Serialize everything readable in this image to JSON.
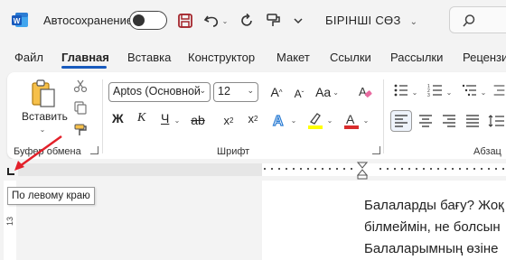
{
  "titlebar": {
    "app_icon": "word-logo-icon",
    "autosave_label": "Автосохранение",
    "autosave_on": false,
    "doc_title": "БІРІНШІ СӨЗ",
    "search_icon": "search-icon"
  },
  "tabs": [
    {
      "label": "Файл",
      "active": false
    },
    {
      "label": "Главная",
      "active": true
    },
    {
      "label": "Вставка",
      "active": false
    },
    {
      "label": "Конструктор",
      "active": false
    },
    {
      "label": "Макет",
      "active": false
    },
    {
      "label": "Ссылки",
      "active": false
    },
    {
      "label": "Рассылки",
      "active": false
    },
    {
      "label": "Рецензи",
      "active": false
    }
  ],
  "ribbon": {
    "clipboard": {
      "paste_label": "Вставить",
      "group_label": "Буфер обмена"
    },
    "font": {
      "font_name": "Aptos (Основной",
      "font_size": "12",
      "bold": "Ж",
      "italic": "К",
      "underline": "Ч",
      "group_label": "Шрифт"
    },
    "paragraph": {
      "group_label": "Абзац"
    }
  },
  "tooltip": "По левому краю",
  "vruler_number": "13",
  "document": {
    "lines": [
      "Балаларды бағу? Жоқ",
      "білмеймін, не болсын",
      "Балаларымның өзіне"
    ]
  },
  "colors": {
    "accent": "#185abd",
    "highlight": "#ffff00",
    "font_color": "#d92c2c",
    "save_icon": "#a4262c"
  }
}
